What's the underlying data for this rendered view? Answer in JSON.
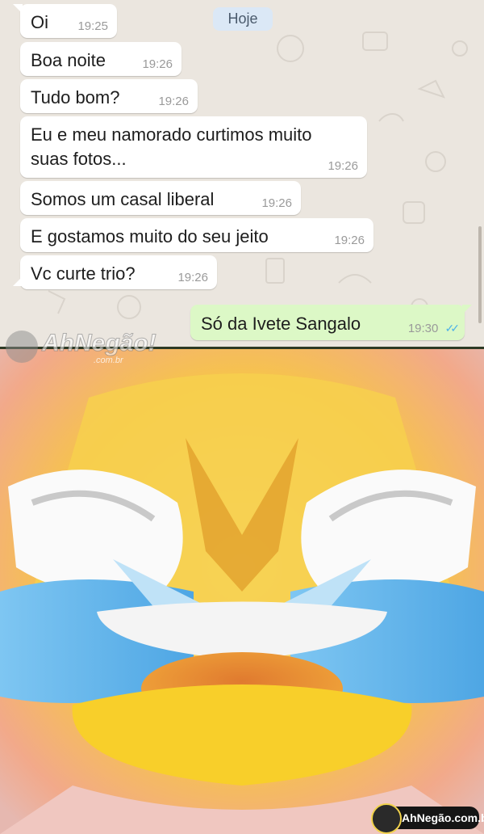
{
  "chat": {
    "date_chip": "Hoje",
    "messages": [
      {
        "text": "Oi",
        "time": "19:25",
        "direction": "incoming"
      },
      {
        "text": "Boa noite",
        "time": "19:26",
        "direction": "incoming"
      },
      {
        "text": "Tudo bom?",
        "time": "19:26",
        "direction": "incoming"
      },
      {
        "text_line1": "Eu e meu namorado curtimos muito",
        "text_line2": "suas fotos...",
        "time": "19:26",
        "direction": "incoming"
      },
      {
        "text": "Somos um casal liberal",
        "time": "19:26",
        "direction": "incoming"
      },
      {
        "text": "E gostamos muito do seu jeito",
        "time": "19:26",
        "direction": "incoming"
      },
      {
        "text": "Vc curte trio?",
        "time": "19:26",
        "direction": "incoming"
      },
      {
        "text": "Só da Ivete Sangalo",
        "time": "19:30",
        "direction": "outgoing",
        "status_icon": "double-check-icon",
        "status_color": "#4fb2e7"
      }
    ],
    "colors": {
      "background": "#ebe6df",
      "incoming_bubble": "#ffffff",
      "outgoing_bubble": "#dcf8c6",
      "date_chip": "#dbe8f6"
    }
  },
  "watermark_top": {
    "logo": "AhNegão!",
    "domain": ".com.br"
  },
  "meme_image": {
    "subject": "zoomed-laughing-crying-emoji",
    "colors": {
      "face": "#f7c531",
      "tears": "#5fb3ea",
      "mouth": "#e8843a"
    }
  },
  "footer_badge": {
    "text": "AhNegão.com.br"
  }
}
